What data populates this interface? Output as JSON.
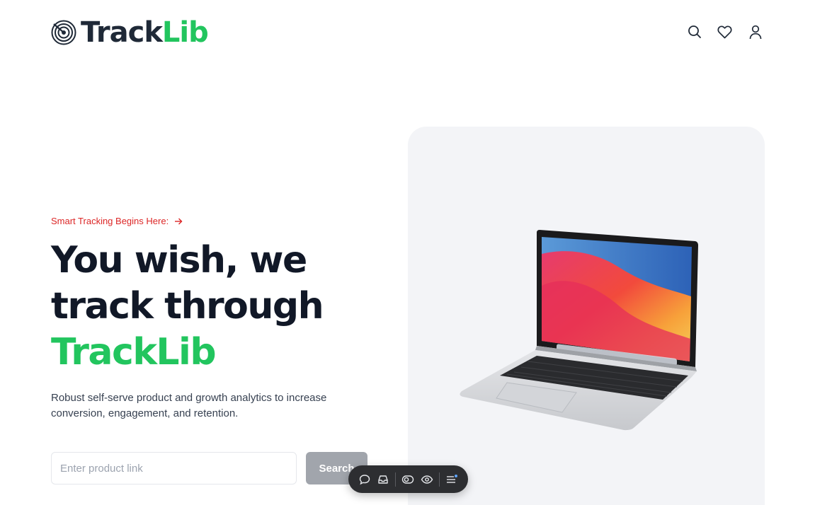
{
  "header": {
    "logo": {
      "part1": "Track",
      "part2": "Lib",
      "mark_icon": "target-rings-icon"
    },
    "nav": [
      {
        "name": "search-icon"
      },
      {
        "name": "heart-icon"
      },
      {
        "name": "user-icon"
      }
    ]
  },
  "hero": {
    "eyebrow": "Smart Tracking Begins Here:",
    "headline": {
      "line1": "You wish, we",
      "line2": "track through",
      "brand": "TrackLib"
    },
    "description": "Robust self-serve product and growth analytics to increase conversion, engagement, and retention.",
    "search": {
      "placeholder": "Enter product link",
      "value": "",
      "button_label": "Search"
    },
    "image": "laptop-image"
  },
  "toolbar": {
    "items": [
      "comment-icon",
      "inbox-icon",
      "toggle-icon",
      "eye-icon",
      "menu-icon"
    ]
  },
  "colors": {
    "accent_green": "#22c55e",
    "eyebrow_red": "#dc2626",
    "text_dark": "#111827",
    "card_bg": "#f3f4f7",
    "button_gray": "#a1a5ac"
  }
}
